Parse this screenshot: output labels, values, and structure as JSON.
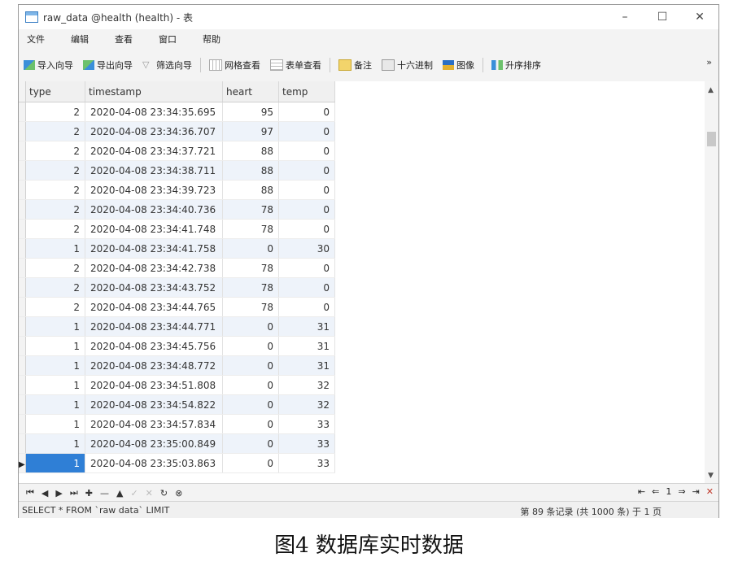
{
  "window": {
    "title": "raw_data @health (health) - 表",
    "controls": {
      "minimize": "–",
      "maximize": "☐",
      "close": "✕"
    }
  },
  "menu": [
    "文件",
    "编辑",
    "查看",
    "窗口",
    "帮助"
  ],
  "toolbar": {
    "import_wizard": "导入向导",
    "export_wizard": "导出向导",
    "filter_wizard": "筛选向导",
    "grid_view": "网格查看",
    "form_view": "表单查看",
    "memo": "备注",
    "hex": "十六进制",
    "image": "图像",
    "sort_asc": "升序排序",
    "more": "»"
  },
  "table": {
    "columns": [
      "type",
      "timestamp",
      "heart",
      "temp"
    ],
    "rows": [
      [
        "2",
        "2020-04-08 23:34:35.695",
        "95",
        "0"
      ],
      [
        "2",
        "2020-04-08 23:34:36.707",
        "97",
        "0"
      ],
      [
        "2",
        "2020-04-08 23:34:37.721",
        "88",
        "0"
      ],
      [
        "2",
        "2020-04-08 23:34:38.711",
        "88",
        "0"
      ],
      [
        "2",
        "2020-04-08 23:34:39.723",
        "88",
        "0"
      ],
      [
        "2",
        "2020-04-08 23:34:40.736",
        "78",
        "0"
      ],
      [
        "2",
        "2020-04-08 23:34:41.748",
        "78",
        "0"
      ],
      [
        "1",
        "2020-04-08 23:34:41.758",
        "0",
        "30"
      ],
      [
        "2",
        "2020-04-08 23:34:42.738",
        "78",
        "0"
      ],
      [
        "2",
        "2020-04-08 23:34:43.752",
        "78",
        "0"
      ],
      [
        "2",
        "2020-04-08 23:34:44.765",
        "78",
        "0"
      ],
      [
        "1",
        "2020-04-08 23:34:44.771",
        "0",
        "31"
      ],
      [
        "1",
        "2020-04-08 23:34:45.756",
        "0",
        "31"
      ],
      [
        "1",
        "2020-04-08 23:34:48.772",
        "0",
        "31"
      ],
      [
        "1",
        "2020-04-08 23:34:51.808",
        "0",
        "32"
      ],
      [
        "1",
        "2020-04-08 23:34:54.822",
        "0",
        "32"
      ],
      [
        "1",
        "2020-04-08 23:34:57.834",
        "0",
        "33"
      ],
      [
        "1",
        "2020-04-08 23:35:00.849",
        "0",
        "33"
      ],
      [
        "1",
        "2020-04-08 23:35:03.863",
        "0",
        "33"
      ]
    ],
    "selected_row": 18,
    "current_row_marker": "▶"
  },
  "navbar": {
    "first": "⏮",
    "prev": "◀",
    "next": "▶",
    "last": "⏭",
    "add": "✚",
    "delete": "—",
    "up": "▲",
    "check": "✓",
    "cancel": "✕",
    "refresh": "↻",
    "stop": "⊗",
    "page_first": "⇤",
    "page_prev": "⇐",
    "page_num": "1",
    "page_next": "⇒",
    "page_last": "⇥",
    "close": "✕"
  },
  "status": {
    "sql": "SELECT * FROM `raw data` LIMIT",
    "count": "第 89 条记录 (共 1000 条) 于 1 页"
  },
  "caption": "图4 数据库实时数据",
  "colors": {
    "selection": "#2f7fd6",
    "stripe": "#eef3fa"
  }
}
